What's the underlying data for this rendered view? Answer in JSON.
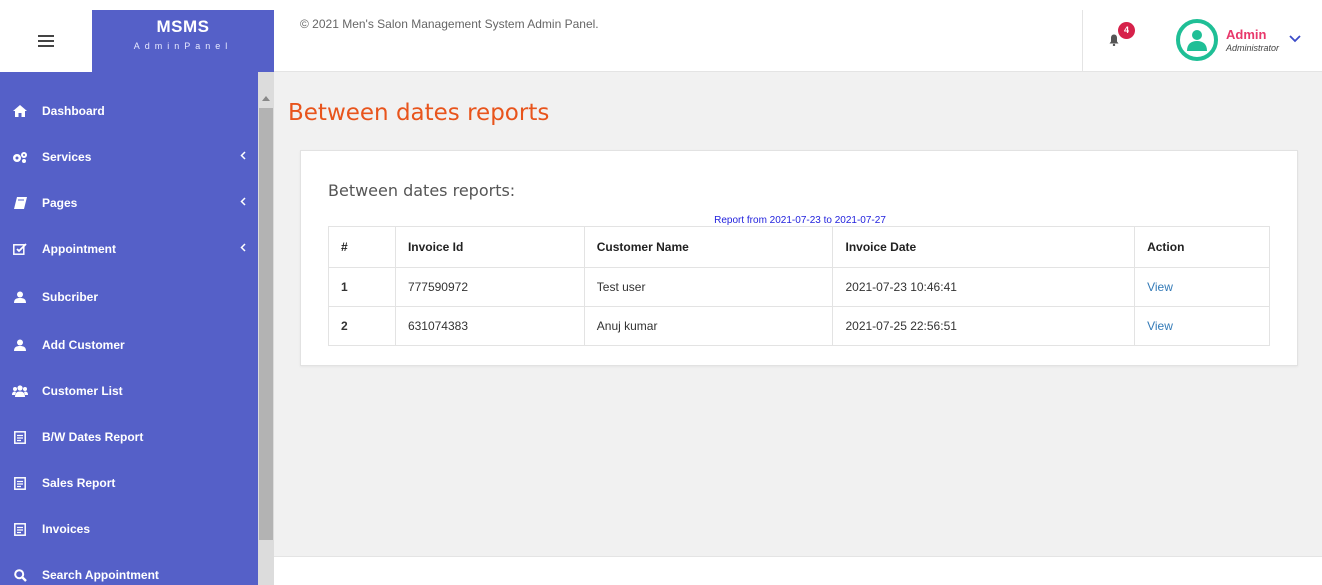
{
  "brand": {
    "title": "MSMS",
    "subtitle": "AdminPanel"
  },
  "notifications": {
    "count": "4"
  },
  "user": {
    "name": "Admin",
    "role": "Administrator"
  },
  "sidebar": {
    "items": [
      {
        "label": "Dashboard",
        "icon": "home-icon"
      },
      {
        "label": "Services",
        "icon": "cogs-icon",
        "has_submenu": true
      },
      {
        "label": "Pages",
        "icon": "book-icon",
        "has_submenu": true
      },
      {
        "label": "Appointment",
        "icon": "edit-icon",
        "has_submenu": true
      },
      {
        "label": "Subcriber",
        "icon": "user-icon"
      },
      {
        "label": "Add Customer",
        "icon": "user-icon"
      },
      {
        "label": "Customer List",
        "icon": "users-icon"
      },
      {
        "label": "B/W Dates Report",
        "icon": "file-icon"
      },
      {
        "label": "Sales Report",
        "icon": "file-icon"
      },
      {
        "label": "Invoices",
        "icon": "file-icon"
      },
      {
        "label": "Search Appointment",
        "icon": "search-icon"
      }
    ]
  },
  "main": {
    "page_title": "Between dates reports",
    "card_title": "Between dates reports:",
    "report_range": "Report from 2021-07-23 to 2021-07-27",
    "table": {
      "headers": [
        "#",
        "Invoice Id",
        "Customer Name",
        "Invoice Date",
        "Action"
      ],
      "rows": [
        {
          "num": "1",
          "invoice_id": "777590972",
          "customer": "Test user",
          "date": "2021-07-23 10:46:41",
          "action": "View"
        },
        {
          "num": "2",
          "invoice_id": "631074383",
          "customer": "Anuj kumar",
          "date": "2021-07-25 22:56:51",
          "action": "View"
        }
      ]
    }
  },
  "footer": {
    "text": "© 2021 Men's Salon Management System Admin Panel."
  },
  "colors": {
    "sidebar": "#5560c8",
    "title": "#e8541c",
    "badge": "#d6214a",
    "avatar": "#1fbf96",
    "user_name": "#e8386b",
    "link": "#337ab7"
  }
}
